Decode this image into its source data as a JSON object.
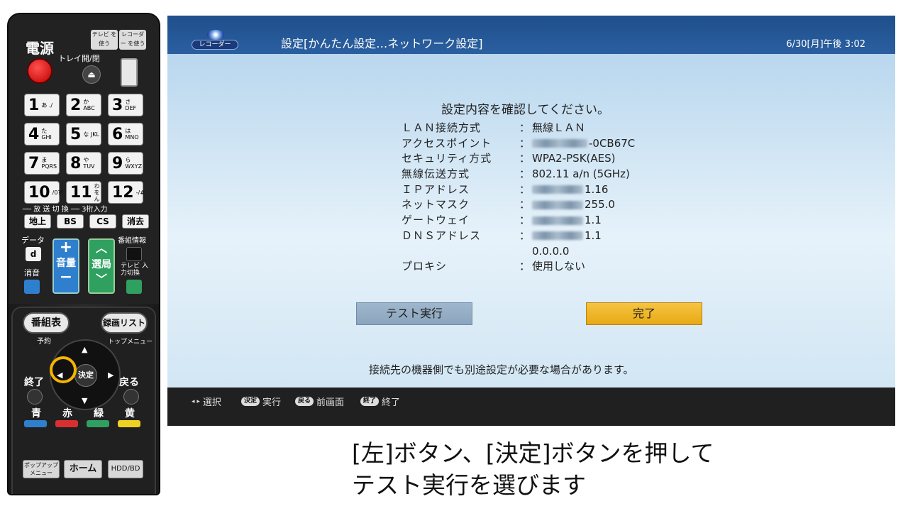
{
  "remote": {
    "power_label": "電源",
    "tray_label": "トレイ開/閉",
    "tray_symbol": "⏏",
    "mode_tv": "テレビ を使う",
    "mode_recorder": "レコーダー を使う",
    "numpad": [
      {
        "num": "1",
        "sub": "あ ./"
      },
      {
        "num": "2",
        "sub": "か ABC"
      },
      {
        "num": "3",
        "sub": "さ DEF"
      },
      {
        "num": "4",
        "sub": "た GHI"
      },
      {
        "num": "5",
        "sub": "な JKL"
      },
      {
        "num": "6",
        "sub": "は MNO"
      },
      {
        "num": "7",
        "sub": "ま PQRS"
      },
      {
        "num": "8",
        "sub": "や TUV"
      },
      {
        "num": "9",
        "sub": "ら WXYZ"
      },
      {
        "num": "10",
        "sub": "/0?!"
      },
      {
        "num": "11",
        "sub": "わをん"
      },
      {
        "num": "12",
        "sub": "-/#"
      }
    ],
    "broadcast_label": "── 放 送 切 換 ── 3桁入力",
    "broadcast_keys": [
      "地上",
      "BS",
      "CS",
      "消去"
    ],
    "data_label": "データ",
    "data_key": "d",
    "mute_label": "消音",
    "volume_label": "音量",
    "channel_label": "選局",
    "program_info_label": "番組情報",
    "tv_input_label": "テレビ 入力切換",
    "guide_button": "番組表",
    "reserve_label": "予約",
    "rec_list_button": "録画リスト",
    "top_menu_label": "トップメニュー",
    "enter_button": "決定",
    "exit_label": "終了",
    "back_label": "戻る",
    "colors": [
      {
        "label": "青",
        "hex": "#2f7fcf"
      },
      {
        "label": "赤",
        "hex": "#d83030"
      },
      {
        "label": "緑",
        "hex": "#2fa060"
      },
      {
        "label": "黄",
        "hex": "#f0d020"
      }
    ],
    "bottom_keys": [
      "ポップアップ メニュー",
      "ホーム",
      "HDD/BD"
    ]
  },
  "screen": {
    "logo_text": "レコーダー",
    "title": "設定[かんたん設定…ネットワーク設定]",
    "clock": "6/30[月]午後 3:02",
    "confirm_message": "設定内容を確認してください。",
    "settings": [
      {
        "key": "ＬＡＮ接続方式",
        "value": "無線ＬＡＮ"
      },
      {
        "key": "アクセスポイント",
        "value": "-0CB67C"
      },
      {
        "key": "セキュリティ方式",
        "value": "WPA2-PSK(AES)"
      },
      {
        "key": "無線伝送方式",
        "value": "802.11 a/n (5GHz)"
      },
      {
        "key": "ＩＰアドレス",
        "value": "1.16"
      },
      {
        "key": "ネットマスク",
        "value": "255.0"
      },
      {
        "key": "ゲートウェイ",
        "value": "1.1"
      },
      {
        "key": "ＤＮＳアドレス",
        "value": "1.1"
      },
      {
        "key": "",
        "value": "0.0.0.0"
      },
      {
        "key": "プロキシ",
        "value": "使用しない"
      }
    ],
    "test_button": "テスト実行",
    "done_button": "完了",
    "note": "接続先の機器側でも別途設定が必要な場合があります。",
    "footer": {
      "select_label": "選択",
      "enter_badge": "決定",
      "enter_label": "実行",
      "back_badge": "戻る",
      "back_label": "前画面",
      "exit_badge": "終了",
      "exit_label": "終了"
    }
  },
  "caption": {
    "line1": "[左]ボタン、[決定]ボタンを押して",
    "line2": "テスト実行を選びます"
  }
}
